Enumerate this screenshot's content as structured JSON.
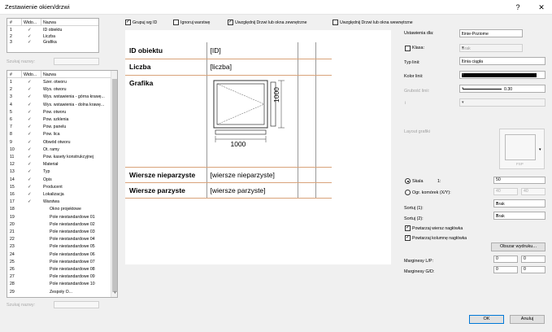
{
  "window": {
    "title": "Zestawienie okien/drzwi",
    "help": "?",
    "close": "✕"
  },
  "top_list": {
    "headers": [
      "#",
      "Wido...",
      "Nazwa"
    ],
    "rows": [
      {
        "n": "1",
        "name": "ID obiektu"
      },
      {
        "n": "2",
        "name": "Liczba"
      },
      {
        "n": "3",
        "name": "Grafika"
      }
    ]
  },
  "filter_top_label": "Szukaj nazwy:",
  "filter_bottom_label": "Szukaj nazwy:",
  "main_list": {
    "headers": [
      "#",
      "Wido...",
      "Nazwa"
    ],
    "rows": [
      {
        "n": "1",
        "vis": true,
        "name": "Szer. otworu"
      },
      {
        "n": "2",
        "vis": true,
        "name": "Wys. otworu"
      },
      {
        "n": "3",
        "vis": true,
        "name": "Wys. wstawienia - górna krawę..."
      },
      {
        "n": "4",
        "vis": true,
        "name": "Wys. wstawienia - dolna krawę..."
      },
      {
        "n": "5",
        "vis": true,
        "name": "Pow. otworu"
      },
      {
        "n": "6",
        "vis": true,
        "name": "Pow. szklenia"
      },
      {
        "n": "7",
        "vis": true,
        "name": "Pow. panelu"
      },
      {
        "n": "8",
        "vis": true,
        "name": "Pow. lica"
      },
      {
        "n": "9",
        "vis": true,
        "name": "Obwód otworu"
      },
      {
        "n": "10",
        "vis": true,
        "name": "Ot. ramy"
      },
      {
        "n": "11",
        "vis": true,
        "name": "Pow. kasety konstrukcyjnej"
      },
      {
        "n": "12",
        "vis": true,
        "name": "Materiał"
      },
      {
        "n": "13",
        "vis": true,
        "name": "Typ"
      },
      {
        "n": "14",
        "vis": true,
        "name": "Opis"
      },
      {
        "n": "15",
        "vis": true,
        "name": "Producent"
      },
      {
        "n": "16",
        "vis": true,
        "name": "Lokalizacja"
      },
      {
        "n": "17",
        "vis": true,
        "name": "Warstwa"
      },
      {
        "n": "18",
        "vis": false,
        "name": "Okno projektowe"
      },
      {
        "n": "19",
        "vis": false,
        "name": "Pole niestandardowe 01"
      },
      {
        "n": "20",
        "vis": false,
        "name": "Pole niestandardowe 02"
      },
      {
        "n": "21",
        "vis": false,
        "name": "Pole niestandardowe 03"
      },
      {
        "n": "22",
        "vis": false,
        "name": "Pole niestandardowe 04"
      },
      {
        "n": "23",
        "vis": false,
        "name": "Pole niestandardowe 05"
      },
      {
        "n": "24",
        "vis": false,
        "name": "Pole niestandardowe 06"
      },
      {
        "n": "25",
        "vis": false,
        "name": "Pole niestandardowe 07"
      },
      {
        "n": "26",
        "vis": false,
        "name": "Pole niestandardowe 08"
      },
      {
        "n": "27",
        "vis": false,
        "name": "Pole niestandardowe 09"
      },
      {
        "n": "28",
        "vis": false,
        "name": "Pole niestandardowe 10"
      },
      {
        "n": "29",
        "vis": false,
        "name": "Zespoły O..."
      }
    ]
  },
  "options": {
    "group_by_id": {
      "label": "Grupuj wg ID",
      "checked": true
    },
    "ignore_layers": {
      "label": "Ignoruj warstwę",
      "checked": false
    },
    "include_window_in": {
      "label": "Uwzględnij Drzwi lub okna zewnętrzne",
      "checked": true
    },
    "include_door_out": {
      "label": "Uwzględnij Drzwi lub okna wewnętrzne",
      "checked": false
    }
  },
  "preview": {
    "rows": [
      {
        "label": "ID obiektu",
        "value": "[ID]"
      },
      {
        "label": "Liczba",
        "value": "[liczba]"
      },
      {
        "label": "Grafika",
        "value": ""
      },
      {
        "label": "Wiersze nieparzyste",
        "value": "[wiersze nieparzyste]"
      },
      {
        "label": "Wiersze parzyste",
        "value": "[wiersze parzyste]"
      }
    ],
    "dim_width": "1000",
    "dim_height": "1000"
  },
  "settings": {
    "settings_for_label": "Ustawienia dla:",
    "settings_for_value": "Linie-Poziome",
    "class_label": "Klasa:",
    "class_value": "Brak",
    "line_type_label": "Typ linii:",
    "line_type_value": "Linia ciągła",
    "line_color_label": "Kolor linii:",
    "line_color": "#000000",
    "line_weight_label": "Grubość linii:",
    "line_weight_value": "0.30",
    "extra_label": "i",
    "graphic_layout_label": "Layout grafiki",
    "graphic_caption": "FSP",
    "scale_label": "Skala",
    "scale_prefix": "1:",
    "scale_value": "50",
    "cell_limit_label": "Ogr. komórek (X/Y):",
    "cell_x": "40",
    "cell_y": "40",
    "sort1_label": "Sortuj (1):",
    "sort1_value": "Brak",
    "sort2_label": "Sortuj (2):",
    "sort2_value": "Brak",
    "repeat_header_row": "Powtarzaj wiersz nagłówka",
    "repeat_header_col": "Powtarzaj kolumnę nagłówka",
    "print_area_button": "Obszar wydruku...",
    "margins_lr_label": "Marginesy L/P:",
    "margin_l": "0",
    "margin_r": "0",
    "margins_tb_label": "Marginesy G/D:",
    "margin_t": "0",
    "margin_b": "0"
  },
  "footer": {
    "ok": "OK",
    "cancel": "Anuluj"
  },
  "accent_color": "#d9a37a"
}
